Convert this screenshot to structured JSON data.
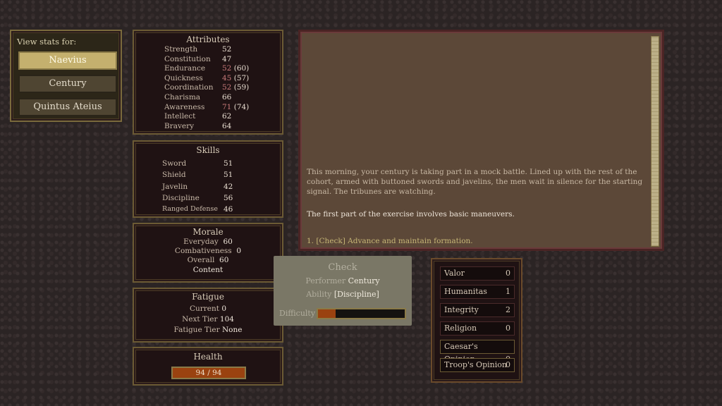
{
  "view_stats": {
    "label": "View stats for:",
    "buttons": [
      {
        "label": "Naevius",
        "active": true
      },
      {
        "label": "Century",
        "active": false
      },
      {
        "label": "Quintus Ateius",
        "active": false
      }
    ]
  },
  "attributes": {
    "title": "Attributes",
    "items": [
      {
        "label": "Strength",
        "value": "52",
        "modified": ""
      },
      {
        "label": "Constitution",
        "value": "47",
        "modified": ""
      },
      {
        "label": "Endurance",
        "value": "52",
        "modified": "(60)"
      },
      {
        "label": "Quickness",
        "value": "45",
        "modified": "(57)"
      },
      {
        "label": "Coordination",
        "value": "52",
        "modified": "(59)"
      },
      {
        "label": "Charisma",
        "value": "66",
        "modified": ""
      },
      {
        "label": "Awareness",
        "value": "71",
        "modified": "(74)"
      },
      {
        "label": "Intellect",
        "value": "62",
        "modified": ""
      },
      {
        "label": "Bravery",
        "value": "64",
        "modified": ""
      }
    ]
  },
  "skills": {
    "title": "Skills",
    "items": [
      {
        "label": "Sword",
        "value": "51"
      },
      {
        "label": "Shield",
        "value": "51"
      },
      {
        "label": "Javelin",
        "value": "42"
      },
      {
        "label": "Discipline",
        "value": "56"
      },
      {
        "label": "Ranged Defense",
        "value": "46"
      }
    ]
  },
  "morale": {
    "title": "Morale",
    "everyday_label": "Everyday",
    "everyday": "60",
    "combativeness_label": "Combativeness",
    "combativeness": "0",
    "overall_label": "Overall",
    "overall": "60",
    "status": "Content"
  },
  "fatigue": {
    "title": "Fatigue",
    "current_label": "Current",
    "current": "0",
    "next_tier_label": "Next Tier",
    "next_tier": "104",
    "tier_label": "Fatigue Tier",
    "tier": "None"
  },
  "health": {
    "title": "Health",
    "text": "94 / 94",
    "fraction": 1.0,
    "color": "#9a4210"
  },
  "story": {
    "paragraph1": "This morning, your century is taking part in a mock battle. Lined up with the rest of the cohort, armed with buttoned swords and javelins, the men wait in silence for the starting signal. The tribunes are watching.",
    "paragraph2": "The first part of the exercise involves basic maneuvers.",
    "choice": "1. [Check] Advance and maintain formation."
  },
  "tooltip": {
    "title": "Check",
    "performer_label": "Performer",
    "performer": "Century",
    "ability_label": "Ability",
    "ability": "[Discipline]",
    "difficulty_label": "Difficulty",
    "difficulty_fraction": 0.2
  },
  "reputation": [
    {
      "label": "Valor",
      "value": "0"
    },
    {
      "label": "Humanitas",
      "value": "1"
    },
    {
      "label": "Integrity",
      "value": "2"
    },
    {
      "label": "Religion",
      "value": "0"
    },
    {
      "label": "Caesar's Opinion",
      "value": "0"
    },
    {
      "label": "Troop's Opinion",
      "value": "0"
    }
  ]
}
